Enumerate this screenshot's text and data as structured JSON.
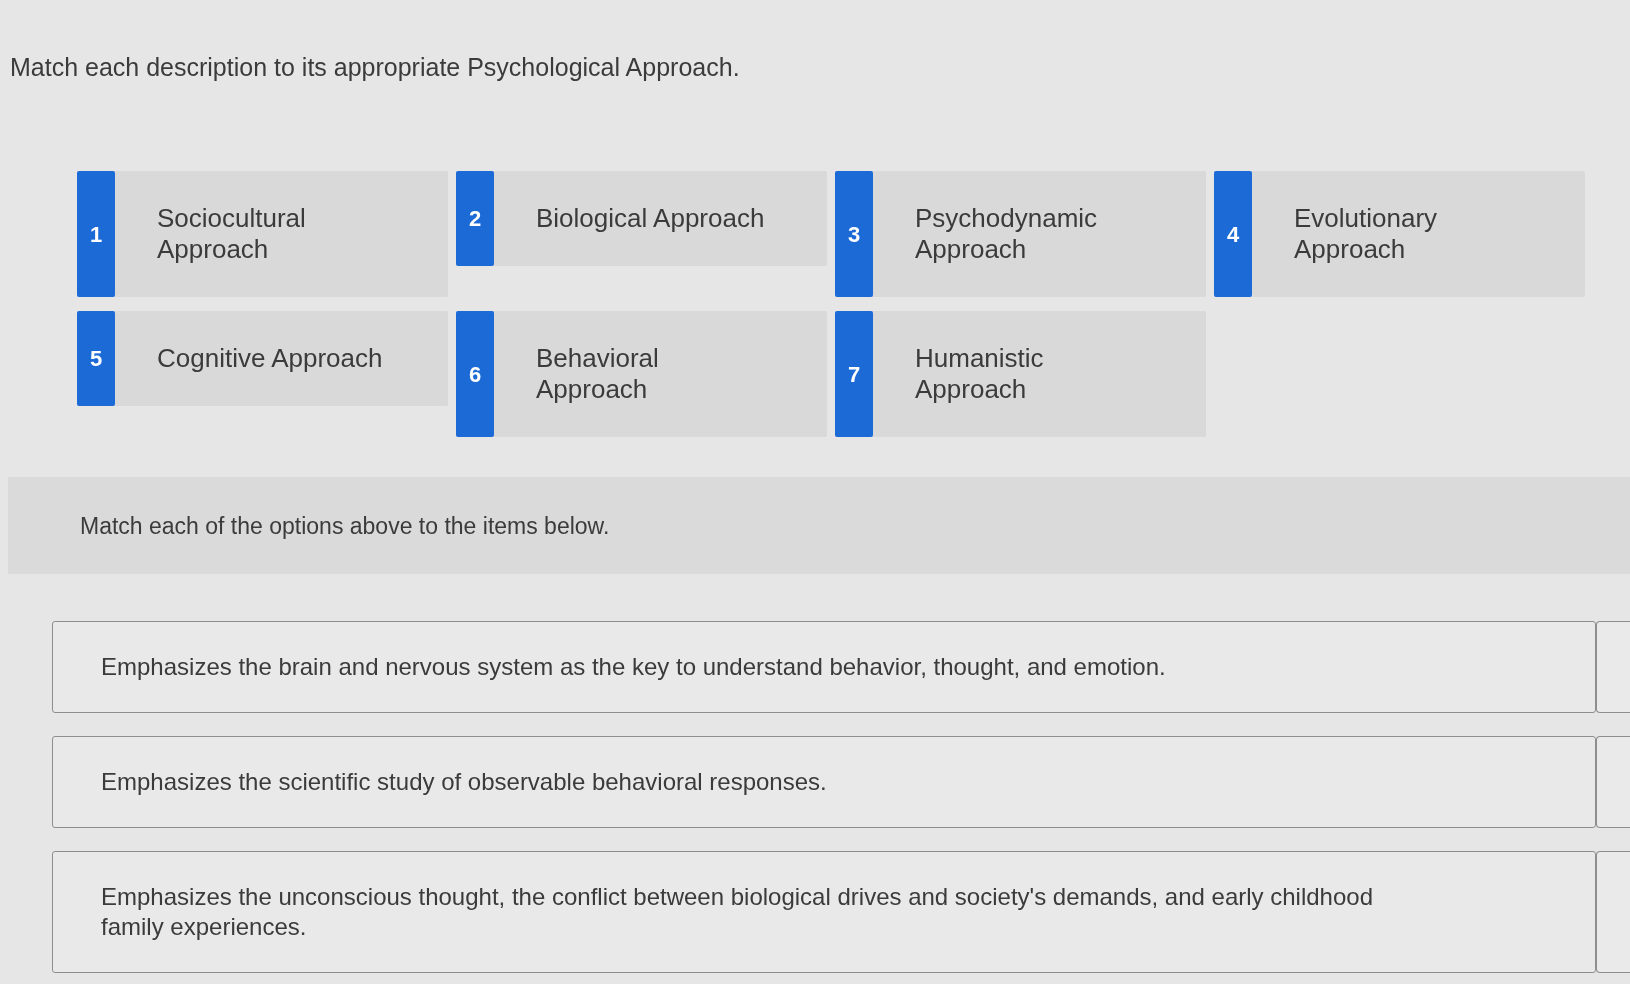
{
  "instructions": "Match each description to its appropriate Psychological Approach.",
  "options": [
    {
      "number": "1",
      "label": "Sociocultural Approach"
    },
    {
      "number": "2",
      "label": "Biological Approach"
    },
    {
      "number": "3",
      "label": "Psychodynamic Approach"
    },
    {
      "number": "4",
      "label": "Evolutionary Approach"
    },
    {
      "number": "5",
      "label": "Cognitive Approach"
    },
    {
      "number": "6",
      "label": "Behavioral Approach"
    },
    {
      "number": "7",
      "label": "Humanistic Approach"
    }
  ],
  "prompt": "Match each of the options above to the items below.",
  "items": [
    {
      "text": "Emphasizes the brain and nervous system as the key to understand behavior, thought, and emotion."
    },
    {
      "text": "Emphasizes the scientific study of observable behavioral responses."
    },
    {
      "text": "Emphasizes the unconscious thought, the conflict between biological drives and society's demands, and early childhood family experiences."
    }
  ]
}
